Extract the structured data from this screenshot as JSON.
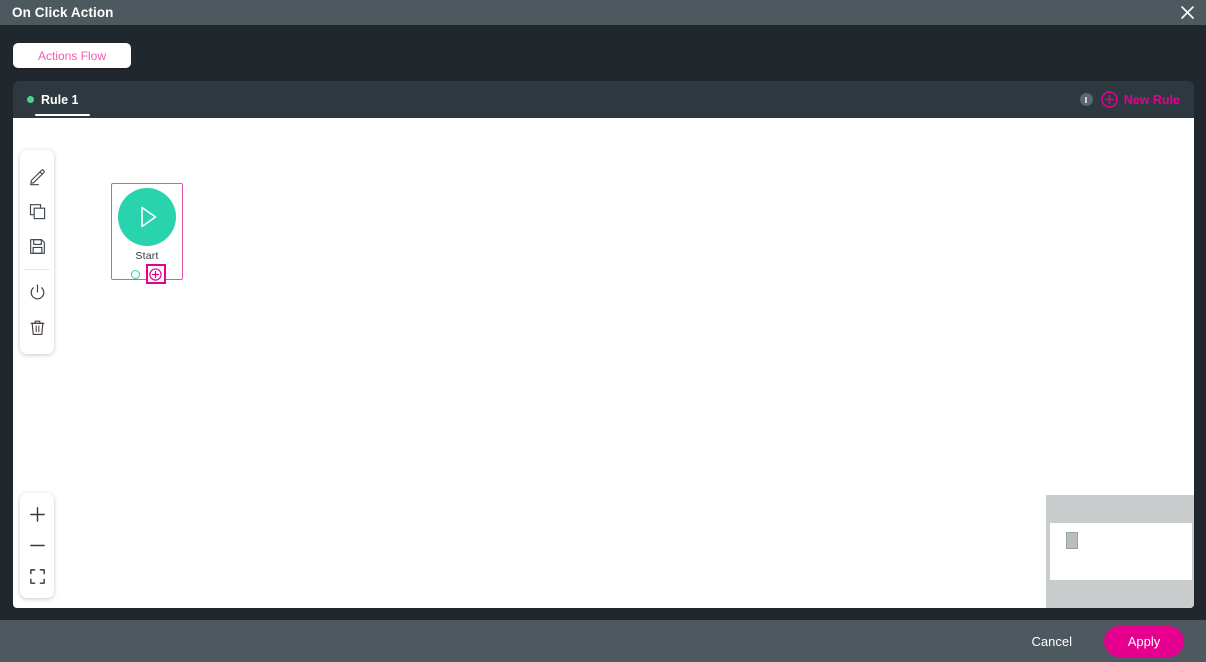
{
  "header": {
    "title": "On Click Action",
    "close_icon": "close-icon"
  },
  "tabs": {
    "items": [
      {
        "label": "Actions Flow",
        "active": true
      }
    ]
  },
  "rule_bar": {
    "rules": [
      {
        "label": "Rule 1",
        "status_color": "#4fd18b",
        "active": true
      }
    ],
    "info_icon": "info-icon",
    "new_rule": {
      "label": "New Rule",
      "icon": "plus-circle-icon",
      "color": "#e6008f"
    }
  },
  "canvas": {
    "toolbar": {
      "items": [
        {
          "name": "edit-tool",
          "icon": "pencil-icon"
        },
        {
          "name": "duplicate-tool",
          "icon": "copy-icon"
        },
        {
          "name": "save-tool",
          "icon": "floppy-disk-icon"
        },
        {
          "name": "power-tool",
          "icon": "power-icon"
        },
        {
          "name": "delete-tool",
          "icon": "trash-icon"
        }
      ]
    },
    "zoom_controls": [
      {
        "name": "zoom-in-button",
        "icon": "plus-icon"
      },
      {
        "name": "zoom-out-button",
        "icon": "minus-icon"
      },
      {
        "name": "fit-to-screen-button",
        "icon": "expand-icon"
      }
    ],
    "nodes": [
      {
        "label": "Start",
        "icon": "play-icon",
        "color": "#28d3ae",
        "selected": true,
        "add_port_highlighted": true
      }
    ],
    "minimap": {
      "name": "minimap"
    }
  },
  "footer": {
    "cancel_label": "Cancel",
    "apply_label": "Apply",
    "apply_color": "#e6008f"
  }
}
